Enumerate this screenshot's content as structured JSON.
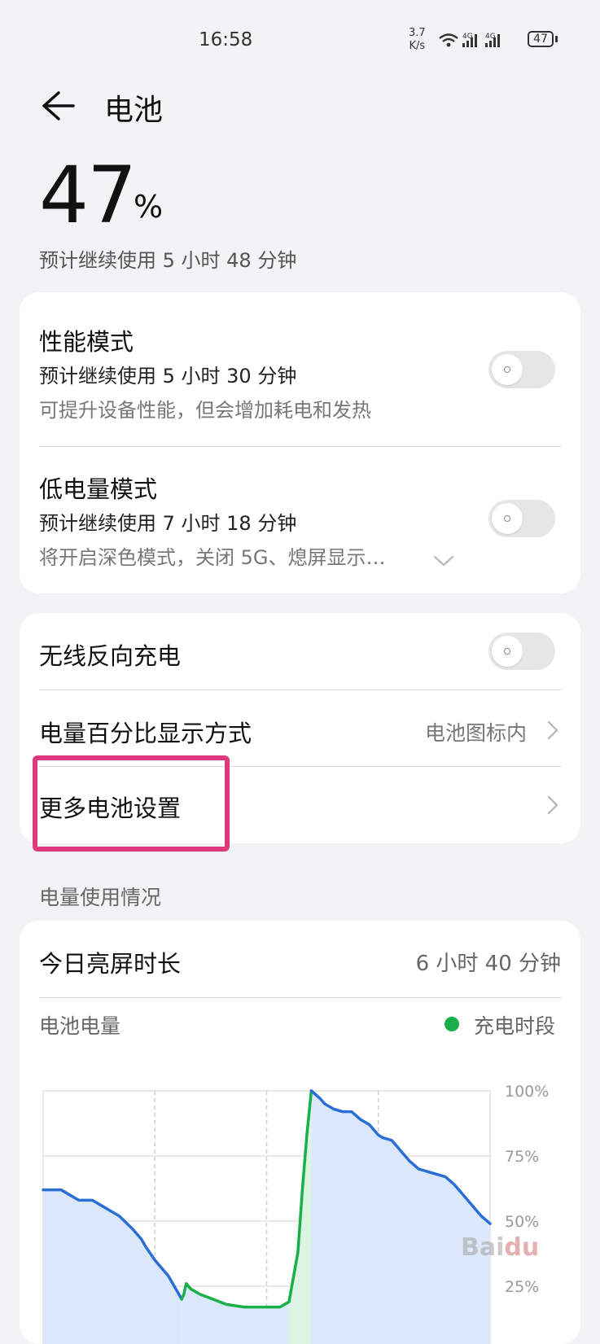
{
  "status_bar": {
    "time": "16:58",
    "net_speed_value": "3.7",
    "net_speed_unit": "K/s",
    "network_1": "4G",
    "network_2": "4G",
    "battery": "47"
  },
  "header": {
    "title": "电池"
  },
  "battery": {
    "percent": "47",
    "percent_sign": "%",
    "estimate": "预计继续使用 5 小时 48 分钟"
  },
  "modes": [
    {
      "title": "性能模式",
      "estimate": "预计继续使用 5 小时 30 分钟",
      "desc": "可提升设备性能，但会增加耗电和发热",
      "enabled": false
    },
    {
      "title": "低电量模式",
      "estimate": "预计继续使用 7 小时 18 分钟",
      "desc": "将开启深色模式，关闭 5G、熄屏显示…",
      "enabled": false
    }
  ],
  "settings": {
    "wireless_reverse": {
      "label": "无线反向充电",
      "enabled": false
    },
    "percent_display": {
      "label": "电量百分比显示方式",
      "value": "电池图标内"
    },
    "more_settings": {
      "label": "更多电池设置"
    }
  },
  "usage": {
    "section_label": "电量使用情况",
    "screen_time_label": "今日亮屏时长",
    "screen_time_value": "6 小时 40 分钟",
    "battery_level_label": "电池电量",
    "legend_charging": "充电时段"
  },
  "colors": {
    "discharge_line": "#2b6fd6",
    "charge_line": "#19b04a",
    "discharge_fill": "#dbe7fb",
    "charge_fill": "#dcf5e3",
    "highlight": "#dc3a7a"
  },
  "chart_data": {
    "type": "area",
    "y_ticks": [
      "100%",
      "75%",
      "50%",
      "25%"
    ],
    "ylim": [
      0,
      100
    ],
    "xlim": [
      0,
      100
    ],
    "discharge_before": [
      [
        0,
        62
      ],
      [
        4,
        62
      ],
      [
        5,
        61
      ],
      [
        7,
        59
      ],
      [
        8,
        58
      ],
      [
        10,
        58
      ],
      [
        11,
        58
      ],
      [
        13,
        56
      ],
      [
        15,
        54
      ],
      [
        17,
        52
      ],
      [
        20,
        47
      ],
      [
        22,
        43
      ],
      [
        23,
        40
      ],
      [
        25,
        35
      ],
      [
        26,
        33
      ],
      [
        28,
        29
      ],
      [
        30,
        23
      ],
      [
        31,
        20
      ]
    ],
    "discharge_mid": [
      [
        31,
        20
      ],
      [
        31.5,
        22
      ],
      [
        32,
        26
      ],
      [
        33,
        24
      ],
      [
        35,
        22
      ],
      [
        38,
        20
      ],
      [
        41,
        18
      ],
      [
        45,
        17
      ],
      [
        48,
        17
      ],
      [
        51,
        17
      ],
      [
        53,
        17
      ],
      [
        55,
        19
      ]
    ],
    "charging": [
      [
        55,
        19
      ],
      [
        57,
        38
      ],
      [
        58,
        62
      ],
      [
        59,
        83
      ],
      [
        60,
        100
      ]
    ],
    "discharge_after": [
      [
        60,
        100
      ],
      [
        62,
        97
      ],
      [
        63,
        95
      ],
      [
        65,
        93
      ],
      [
        67,
        92
      ],
      [
        69,
        92
      ],
      [
        71,
        89
      ],
      [
        73,
        87
      ],
      [
        75,
        83
      ],
      [
        76,
        82
      ],
      [
        78,
        81
      ],
      [
        80,
        77
      ],
      [
        82,
        73
      ],
      [
        84,
        70
      ],
      [
        86,
        69
      ],
      [
        88,
        68
      ],
      [
        90,
        67
      ],
      [
        92,
        64
      ],
      [
        94,
        60
      ],
      [
        96,
        56
      ],
      [
        98,
        52
      ],
      [
        100,
        49
      ]
    ]
  }
}
